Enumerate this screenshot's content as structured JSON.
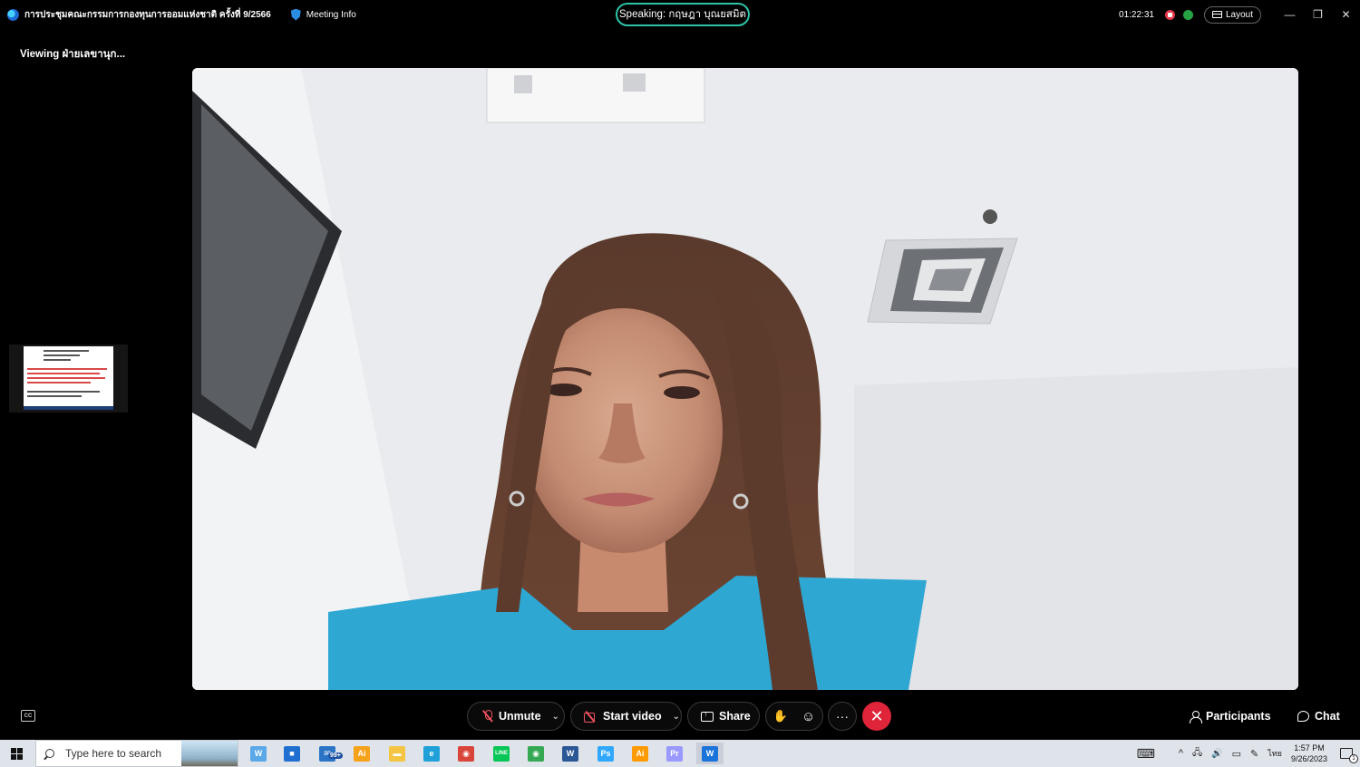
{
  "titlebar": {
    "meeting_title": "การประชุมคณะกรรมการกองทุนการออมแห่งชาติ ครั้งที่ 9/2566",
    "meeting_info": "Meeting Info",
    "speaking": "Speaking: กฤษฎา บุณยสมิต",
    "timer": "01:22:31",
    "layout_label": "Layout",
    "minimize": "—",
    "restore": "❐",
    "close": "✕"
  },
  "viewing": "Viewing ฝ่ายเลขานุก...",
  "controls": {
    "cc_label": "CC",
    "unmute": "Unmute",
    "start_video": "Start video",
    "share": "Share",
    "raise_hand": "✋",
    "reactions": "☺",
    "more": "···",
    "end": "✕",
    "participants": "Participants",
    "chat": "Chat",
    "chevron": "⌄"
  },
  "taskbar": {
    "search_placeholder": "Type here to search",
    "mail_badge": "99+",
    "apps": [
      {
        "name": "webex-taskbar-icon",
        "glyph": "W",
        "color": "#5aa8e8"
      },
      {
        "name": "store-icon",
        "glyph": "■",
        "color": "#1f6fd0"
      },
      {
        "name": "mail-icon",
        "glyph": "✉",
        "color": "#2a74c6"
      },
      {
        "name": "illustrator-icon",
        "glyph": "Ai",
        "color": "#f7a21b"
      },
      {
        "name": "file-explorer-icon",
        "glyph": "▬",
        "color": "#f3c542"
      },
      {
        "name": "edge-icon",
        "glyph": "e",
        "color": "#1fa0d8"
      },
      {
        "name": "chrome-icon",
        "glyph": "◉",
        "color": "#d9453a"
      },
      {
        "name": "line-icon",
        "glyph": "LINE",
        "color": "#06c755"
      },
      {
        "name": "chrome-profile-icon",
        "glyph": "◉",
        "color": "#34a853"
      },
      {
        "name": "word-icon",
        "glyph": "W",
        "color": "#2b5797"
      },
      {
        "name": "photoshop-icon",
        "glyph": "Ps",
        "color": "#31a8ff"
      },
      {
        "name": "illustrator-2-icon",
        "glyph": "Ai",
        "color": "#ff9a00"
      },
      {
        "name": "premiere-icon",
        "glyph": "Pr",
        "color": "#9999ff"
      },
      {
        "name": "webex-meeting-taskbar-icon",
        "glyph": "W",
        "color": "#1a73d9"
      }
    ],
    "keyboard_icon": "⌨",
    "tray_chevron": "^",
    "network": "🖧",
    "volume": "🔊",
    "display": "▭",
    "pen": "✎",
    "lang": "ไทย",
    "time": "1:57 PM",
    "date": "9/26/2023",
    "notif_count": "1"
  },
  "colors": {
    "accent_speaking": "#2ec3a8",
    "end_call": "#e0243a",
    "muted": "#f0525e"
  }
}
